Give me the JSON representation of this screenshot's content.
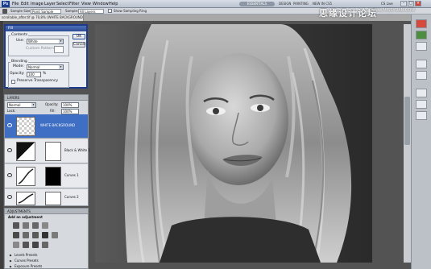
{
  "app": {
    "logo": "Ps"
  },
  "menu": [
    "File",
    "Edit",
    "Image",
    "Layer",
    "Select",
    "Filter",
    "View",
    "Window",
    "Help"
  ],
  "workspace": {
    "active": "ESSENTIALS",
    "links": [
      "DESIGN",
      "PAINTING",
      "NEW IN CS5"
    ],
    "cs_live": "CS Live"
  },
  "options_bar": {
    "sample_size_label": "Sample Size:",
    "sample_size_value": "Point Sample",
    "sample_label": "Sample:",
    "sample_value": "All Layers",
    "show_ring": "Show Sampling Ring"
  },
  "document": {
    "tab_title": "scrollable_after.tif @ 70,8% (WHITE BACKGROUND, RGB/8) *"
  },
  "fill_dialog": {
    "title": "Fill",
    "contents_label": "Contents",
    "use_label": "Use:",
    "use_value": "White",
    "custom_pattern_label": "Custom Pattern:",
    "blending_label": "Blending",
    "mode_label": "Mode:",
    "mode_value": "Normal",
    "opacity_label": "Opacity:",
    "opacity_value": "100",
    "opacity_unit": "%",
    "preserve_label": "Preserve Transparency",
    "ok_label": "OK",
    "cancel_label": "Cancel"
  },
  "layers_panel": {
    "tab": "LAYERS",
    "blend_mode": "Normal",
    "opacity_label": "Opacity:",
    "opacity_value": "100%",
    "lock_label": "Lock:",
    "fill_label": "Fill:",
    "fill_value": "100%",
    "layers": [
      {
        "name": "WHITE BACKGROUND",
        "selected": true
      },
      {
        "name": "Black & White 1",
        "selected": false
      },
      {
        "name": "Curves 1",
        "selected": false
      },
      {
        "name": "Curves 2",
        "selected": false
      }
    ]
  },
  "adjustments_panel": {
    "tab": "ADJUSTMENTS",
    "heading": "Add an adjustment",
    "presets": [
      "Levels Presets",
      "Curves Presets",
      "Exposure Presets"
    ]
  },
  "watermark": {
    "text": "思缘设计论坛",
    "url": "www.MISSYUAN.COM"
  },
  "colors": {
    "selection": "#3e6fc4",
    "dialog_title": "#2c4d96"
  }
}
